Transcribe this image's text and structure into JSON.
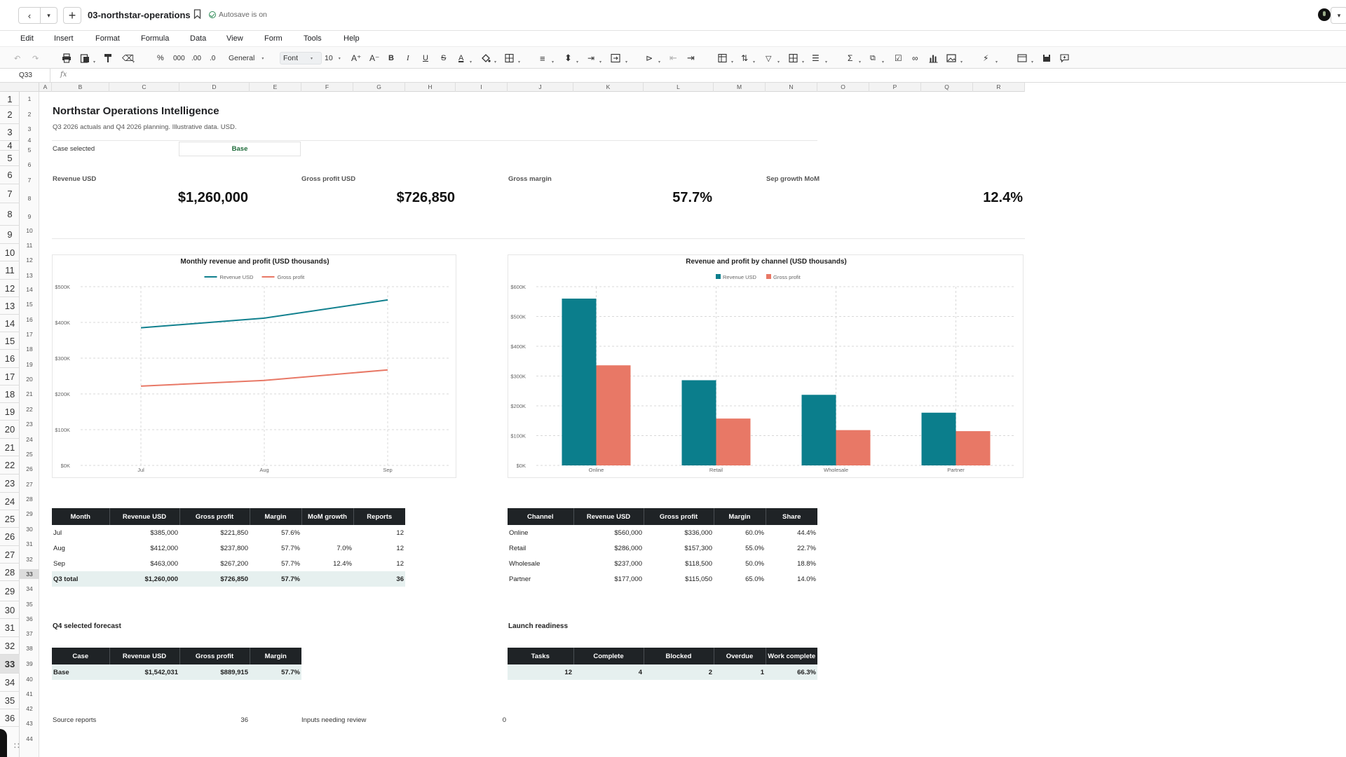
{
  "titlebar": {
    "doc_name": "03-northstar-operations",
    "autosave": "Autosave is on"
  },
  "menu": [
    "Edit",
    "Insert",
    "Format",
    "Formula",
    "Data",
    "View",
    "Form",
    "Tools",
    "Help"
  ],
  "toolbar": {
    "percent": "%",
    "thousands": "000",
    "dec_increase": ".00",
    "dec_decrease": ".0",
    "number_format": "General",
    "font": "Font",
    "font_size": "10",
    "grow_font": "A⁺",
    "shrink_font": "A⁻",
    "bold": "B",
    "italic": "I",
    "underline": "U",
    "strike": "S",
    "text_color": "A",
    "sum": "Σ"
  },
  "formula_bar": {
    "cell_ref": "Q33",
    "fx": "fx",
    "content": ""
  },
  "columns": [
    "A",
    "B",
    "C",
    "D",
    "E",
    "F",
    "G",
    "H",
    "I",
    "J",
    "K",
    "L",
    "M",
    "N",
    "O",
    "P",
    "Q",
    "R"
  ],
  "rows_outer": [
    "1",
    "2",
    "3",
    "4",
    "5",
    "6",
    "7",
    "8",
    "9",
    "10",
    "11",
    "12",
    "13",
    "14",
    "15",
    "16",
    "17",
    "18",
    "19",
    "20",
    "21",
    "22",
    "23",
    "24",
    "25",
    "26",
    "27",
    "28",
    "29",
    "30",
    "31",
    "32",
    "33",
    "34",
    "35",
    "36"
  ],
  "rows_inner": [
    "1",
    "2",
    "3",
    "4",
    "5",
    "6",
    "7",
    "8",
    "9",
    "10",
    "11",
    "12",
    "13",
    "14",
    "15",
    "16",
    "17",
    "18",
    "19",
    "20",
    "21",
    "22",
    "23",
    "24",
    "25",
    "26",
    "27",
    "28",
    "29",
    "30",
    "31",
    "32",
    "33",
    "34",
    "35",
    "36",
    "37",
    "38",
    "39",
    "40",
    "41",
    "42",
    "43",
    "44"
  ],
  "sheet": {
    "title": "Northstar Operations Intelligence",
    "subtitle": "Q3 2026 actuals and Q4 2026 planning. Illustrative data. USD.",
    "case_label": "Case selected",
    "case_value": "Base",
    "kpis": [
      {
        "label": "Revenue USD",
        "value": "$1,260,000"
      },
      {
        "label": "Gross profit USD",
        "value": "$726,850"
      },
      {
        "label": "Gross margin",
        "value": "57.7%"
      },
      {
        "label": "Sep growth MoM",
        "value": "12.4%"
      }
    ],
    "monthly_table": {
      "headers": [
        "Month",
        "Revenue USD",
        "Gross profit",
        "Margin",
        "MoM growth",
        "Reports"
      ],
      "rows": [
        [
          "Jul",
          "$385,000",
          "$221,850",
          "57.6%",
          "",
          "12"
        ],
        [
          "Aug",
          "$412,000",
          "$237,800",
          "57.7%",
          "7.0%",
          "12"
        ],
        [
          "Sep",
          "$463,000",
          "$267,200",
          "57.7%",
          "12.4%",
          "12"
        ]
      ],
      "total": [
        "Q3 total",
        "$1,260,000",
        "$726,850",
        "57.7%",
        "",
        "36"
      ]
    },
    "channel_table": {
      "headers": [
        "Channel",
        "Revenue USD",
        "Gross profit",
        "Margin",
        "Share"
      ],
      "rows": [
        [
          "Online",
          "$560,000",
          "$336,000",
          "60.0%",
          "44.4%"
        ],
        [
          "Retail",
          "$286,000",
          "$157,300",
          "55.0%",
          "22.7%"
        ],
        [
          "Wholesale",
          "$237,000",
          "$118,500",
          "50.0%",
          "18.8%"
        ],
        [
          "Partner",
          "$177,000",
          "$115,050",
          "65.0%",
          "14.0%"
        ]
      ]
    },
    "forecast": {
      "title": "Q4 selected forecast",
      "headers": [
        "Case",
        "Revenue USD",
        "Gross profit",
        "Margin"
      ],
      "row": [
        "Base",
        "$1,542,031",
        "$889,915",
        "57.7%"
      ]
    },
    "readiness": {
      "title": "Launch readiness",
      "headers": [
        "Tasks",
        "Complete",
        "Blocked",
        "Overdue",
        "Work complete"
      ],
      "row": [
        "12",
        "4",
        "2",
        "1",
        "66.3%"
      ]
    },
    "footer": [
      {
        "label": "Source reports",
        "value": "36"
      },
      {
        "label": "Inputs needing review",
        "value": "0"
      }
    ]
  },
  "chart_data": [
    {
      "type": "line",
      "title": "Monthly revenue and profit (USD thousands)",
      "x": [
        "Jul",
        "Aug",
        "Sep"
      ],
      "series": [
        {
          "name": "Revenue USD",
          "values": [
            385,
            412,
            463
          ],
          "color": "#11808e"
        },
        {
          "name": "Gross profit",
          "values": [
            221.85,
            237.8,
            267.2
          ],
          "color": "#e87866"
        }
      ],
      "y_ticks": [
        "$0K",
        "$100K",
        "$200K",
        "$300K",
        "$400K",
        "$500K"
      ],
      "ylim": [
        0,
        500
      ],
      "grid": true,
      "legend": "top-center"
    },
    {
      "type": "bar",
      "title": "Revenue and profit by channel (USD thousands)",
      "categories": [
        "Online",
        "Retail",
        "Wholesale",
        "Partner"
      ],
      "series": [
        {
          "name": "Revenue USD",
          "values": [
            560,
            286,
            237,
            177
          ],
          "color": "#0b7e8c"
        },
        {
          "name": "Gross profit",
          "values": [
            336,
            157.3,
            118.5,
            115.05
          ],
          "color": "#e87866"
        }
      ],
      "y_ticks": [
        "$0K",
        "$100K",
        "$200K",
        "$300K",
        "$400K",
        "$500K",
        "$600K"
      ],
      "ylim": [
        0,
        600
      ],
      "grid": true,
      "legend": "top-center"
    }
  ]
}
